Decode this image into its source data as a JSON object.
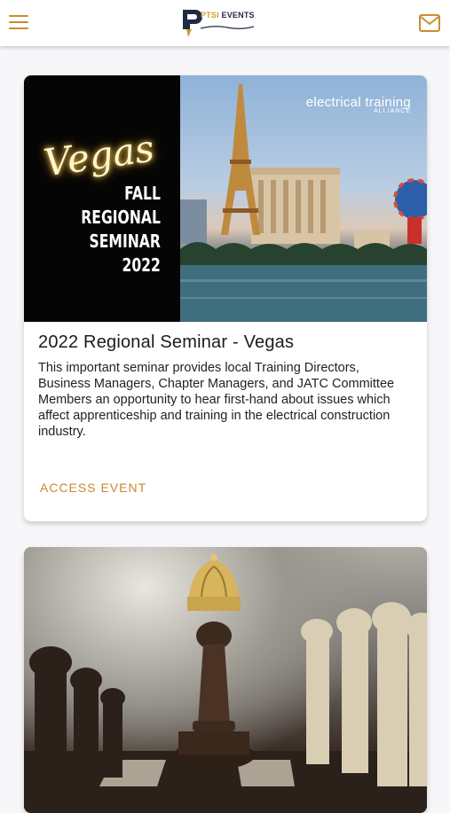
{
  "header": {
    "menu_icon": "hamburger-menu-icon",
    "logo": {
      "prefix": "PTSI",
      "suffix": "EVENTS"
    },
    "mail_icon": "envelope-icon",
    "accent_color": "#c98d2e"
  },
  "events": [
    {
      "image": {
        "script_text": "Vegas",
        "lines": [
          "FALL",
          "REGIONAL",
          "SEMINAR",
          "2022"
        ],
        "partner_logo": {
          "main": "electrical training",
          "sub": "ALLIANCE"
        }
      },
      "title": "2022 Regional Seminar - Vegas",
      "description": "This important seminar provides local Training Directors, Business Managers, Chapter Managers, and JATC Committee Members an opportunity to hear first-hand about issues which affect apprenticeship and training in the electrical construction industry.",
      "action_label": "ACCESS EVENT"
    },
    {
      "image": {
        "subject": "chess-pieces-with-crown"
      }
    }
  ]
}
